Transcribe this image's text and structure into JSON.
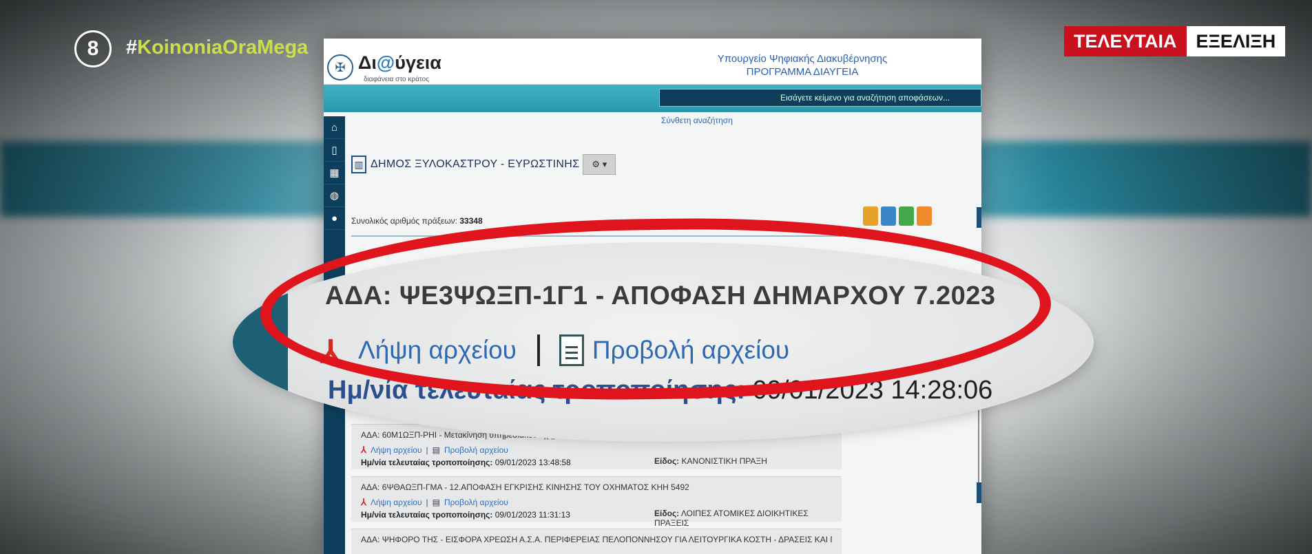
{
  "channel": {
    "logo_text": "8",
    "hashtag_symbol": "#",
    "hashtag_text": "KoinoniaOraMega",
    "breaking_1": "ΤΕΛΕΥΤΑΙΑ",
    "breaking_2": "ΕΞΕΛΙΞΗ"
  },
  "site": {
    "name_prefix": "Δι",
    "name_at": "@",
    "name_suffix": "ύγεια",
    "tagline": "διαφάνεια στο κράτος",
    "ministry_line1": "Υπουργείο Ψηφιακής Διακυβέρνησης",
    "ministry_line2": "ΠΡΟΓΡΑΜΜΑ ΔΙΑΥΓΕΙΑ",
    "search_placeholder": "Εισάγετε κείμενο για αναζήτηση αποφάσεων...",
    "advanced_search": "Σύνθετη αναζήτηση",
    "sidebar_icons": [
      "home-icon",
      "bookmark-icon",
      "grid-icon",
      "globe-icon",
      "chat-icon"
    ],
    "municipality": "ΔΗΜΟΣ ΞΥΛΟΚΑΣΤΡΟΥ - ΕΥΡΩΣΤΙΝΗΣ",
    "gear_label": "⚙ ▾",
    "total_label": "Συνολικός αριθμός πράξεων:",
    "total_value": "33348"
  },
  "magnified": {
    "title": "ΑΔΑ: ΨΕ3ΨΩΞΠ-1Γ1 - ΑΠΟΦΑΣΗ ΔΗΜΑΡΧΟΥ 7.2023",
    "download": "Λήψη αρχείου",
    "view": "Προβολή αρχείου",
    "date_label": "Ημ/νία τελευταίας τροποποίησης:",
    "date_value": "09/01/2023 14:28:06"
  },
  "decisions": [
    {
      "title": "ΑΔΑ: 60Μ1ΩΞΠ-ΡΗΙ - Μετακίνηση υπηρεσιακού οχήματος",
      "download": "Λήψη αρχείου",
      "view": "Προβολή αρχείου",
      "date_label": "Ημ/νία τελευταίας τροποποίησης:",
      "date_value": "09/01/2023 13:48:58",
      "kind_label": "Είδος:",
      "kind_value": "ΚΑΝΟΝΙΣΤΙΚΗ ΠΡΑΞΗ"
    },
    {
      "title": "ΑΔΑ: 6ΨΘΑΩΞΠ-ΓΜΑ - 12.ΑΠΟΦΑΣΗ ΕΓΚΡΙΣΗΣ ΚΙΝΗΣΗΣ ΤΟΥ ΟΧΗΜΑΤΟΣ ΚΗΗ 5492",
      "download": "Λήψη αρχείου",
      "view": "Προβολή αρχείου",
      "date_label": "Ημ/νία τελευταίας τροποποίησης:",
      "date_value": "09/01/2023 11:31:13",
      "kind_label": "Είδος:",
      "kind_value": "ΛΟΙΠΕΣ ΑΤΟΜΙΚΕΣ ΔΙΟΙΚΗΤΙΚΕΣ ΠΡΑΞΕΙΣ"
    },
    {
      "title": "ΑΔΑ: ΨΗΦΟΡΟ ΤΗΣ - ΕΙΣΦΟΡΑ ΧΡΕΩΣΗ Α.Σ.Α. ΠΕΡΙΦΕΡΕΙΑΣ ΠΕΛΟΠΟΝΝΗΣΟΥ ΓΙΑ ΛΕΙΤΟΥΡΓΙΚΑ ΚΟΣΤΗ - ΔΡΑΣΕΙΣ ΚΑΙ ΓΙΑ ΠΑΡΟΧΗ"
    }
  ],
  "colors": {
    "accent_teal": "#2a97ad",
    "sidebar_navy": "#0d3f5c",
    "highlight_red": "#e0141c",
    "breaking_red": "#c8101e",
    "hashtag_green": "#c9e04a"
  }
}
